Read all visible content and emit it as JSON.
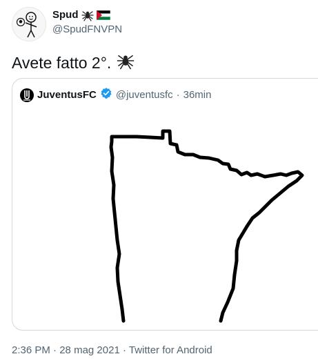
{
  "tweet": {
    "author": {
      "display_name": "Spud",
      "handle": "@SpudFNVPN",
      "avatar_icon": "stick-figure-soccer-avatar-icon",
      "name_emojis": [
        "spider-emoji-icon",
        "palestine-flag-emoji-icon"
      ]
    },
    "text": "Avete fatto 2°.",
    "text_emoji": "spider-emoji-icon",
    "timestamp": {
      "time": "2:36 PM",
      "date": "28 mag 2021",
      "separator": "·",
      "source": "Twitter for Android"
    }
  },
  "quoted_tweet": {
    "display_name": "JuventusFC",
    "handle": "@juventusfc",
    "separator": "·",
    "time": "36min",
    "avatar_icon": "juventus-logo-icon",
    "verified_icon": "verified-badge-icon",
    "media": "minnesota-outline-map-image"
  },
  "colors": {
    "text_primary": "#0f1419",
    "text_secondary": "#536471",
    "border": "#cfd9de",
    "verified": "#1d9bf0",
    "flag_red": "#ce1126",
    "flag_green": "#007a3d"
  }
}
